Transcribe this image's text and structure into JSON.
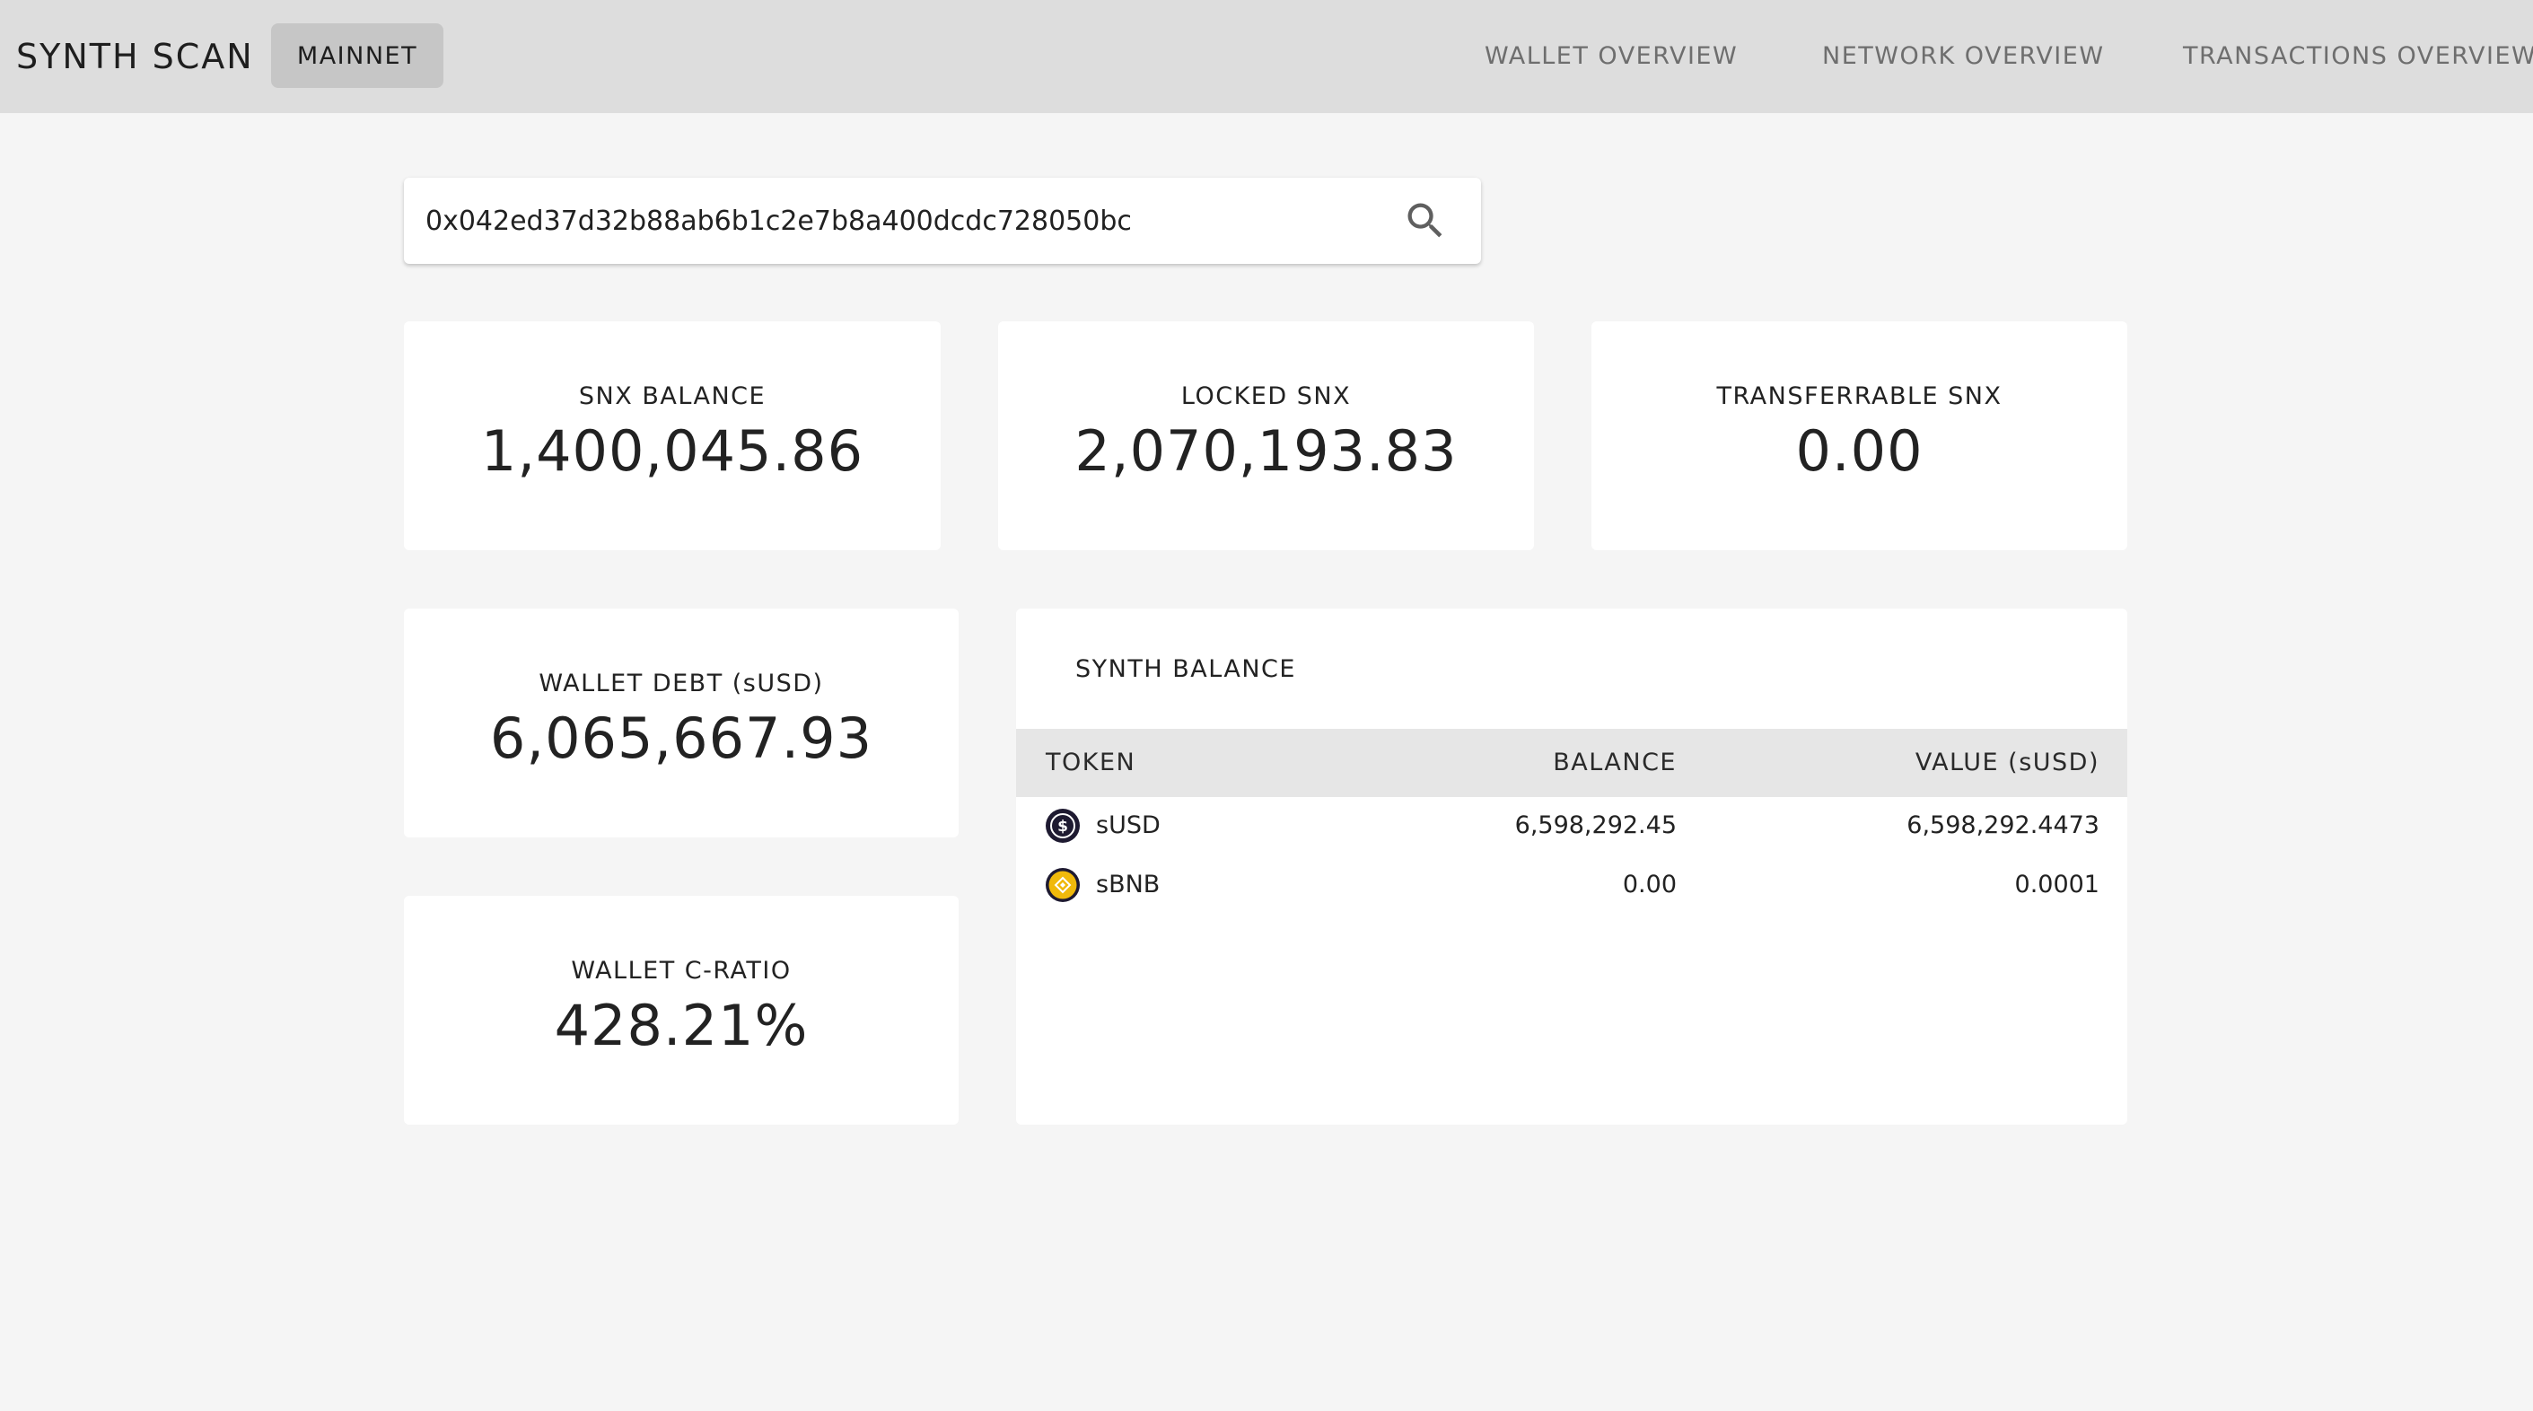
{
  "header": {
    "app_title": "SYNTH SCAN",
    "network_button": "MAINNET",
    "nav": [
      "WALLET OVERVIEW",
      "NETWORK OVERVIEW",
      "TRANSACTIONS OVERVIEW"
    ]
  },
  "search": {
    "value": "0x042ed37d32b88ab6b1c2e7b8a400dcdc728050bc",
    "icon": "search-icon"
  },
  "stats": {
    "snx_balance": {
      "label": "SNX BALANCE",
      "value": "1,400,045.86"
    },
    "locked_snx": {
      "label": "LOCKED SNX",
      "value": "2,070,193.83"
    },
    "transferrable_snx": {
      "label": "TRANSFERRABLE SNX",
      "value": "0.00"
    },
    "wallet_debt": {
      "label": "WALLET DEBT (sUSD)",
      "value": "6,065,667.93"
    },
    "wallet_cratio": {
      "label": "WALLET C-RATIO",
      "value": "428.21%"
    }
  },
  "synth_balance": {
    "title": "SYNTH BALANCE",
    "columns": [
      "TOKEN",
      "BALANCE",
      "VALUE (sUSD)"
    ],
    "rows": [
      {
        "token": "sUSD",
        "balance": "6,598,292.45",
        "value": "6,598,292.4473",
        "icon": "susd-icon"
      },
      {
        "token": "sBNB",
        "balance": "0.00",
        "value": "0.0001",
        "icon": "sbnb-icon"
      }
    ]
  },
  "colors": {
    "background": "#f5f5f5",
    "header": "#dddddd",
    "network_button": "#c6c6c6",
    "card": "#ffffff",
    "table_header": "#e6e6e6",
    "susd_icon": "#1e1a31",
    "sbnb_icon": "#f0b90b"
  }
}
